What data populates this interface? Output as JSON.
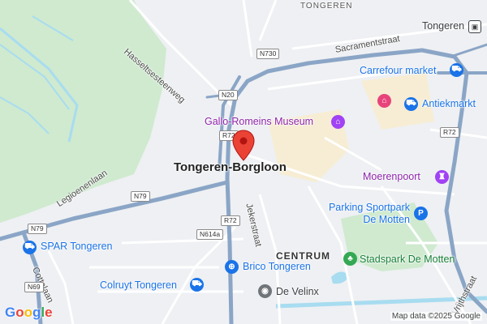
{
  "map": {
    "city_label": "Tongeren-Borgloon",
    "district_label": "CENTRUM",
    "area_label_top": "TONGEREN",
    "station_label": "Tongeren",
    "streets": [
      "Hasseltsesteenweg",
      "Sacramentstraat",
      "Legioenenlaan",
      "Jekerstraat",
      "Cottalaan",
      "Vrijthstraat"
    ],
    "road_shields": [
      "N730",
      "N20",
      "R72",
      "R72",
      "R72",
      "N79",
      "N79",
      "N614a",
      "N69"
    ],
    "pois": [
      {
        "label": "Carrefour market",
        "category": "shopping",
        "icon": "cart-icon"
      },
      {
        "label": "Antiekmarkt",
        "category": "shopping",
        "icon": "cart-icon"
      },
      {
        "label": "Gallo-Romeins Museum",
        "category": "museum",
        "icon": "museum-icon"
      },
      {
        "label": "Moerenpoort",
        "category": "landmark",
        "icon": "castle-icon"
      },
      {
        "label": "Parking Sportpark De Motten",
        "category": "parking",
        "icon": "parking-icon"
      },
      {
        "label": "Stadspark De Motten",
        "category": "park",
        "icon": "tree-icon"
      },
      {
        "label": "SPAR Tongeren",
        "category": "shopping",
        "icon": "cart-icon"
      },
      {
        "label": "Brico Tongeren",
        "category": "shopping",
        "icon": "lock-icon"
      },
      {
        "label": "Colruyt Tongeren",
        "category": "shopping",
        "icon": "cart-icon"
      },
      {
        "label": "De Velinx",
        "category": "venue",
        "icon": "venue-icon"
      }
    ],
    "attribution": "Map data ©2025 Google",
    "logo": "Google",
    "colors": {
      "highway": "#8aa5c6",
      "park": "#cfeacf",
      "water": "#a8dcf0",
      "pin": "#ea4335",
      "blue_poi": "#1a73e8",
      "purple_poi": "#8e24aa",
      "green_poi": "#188038"
    }
  }
}
